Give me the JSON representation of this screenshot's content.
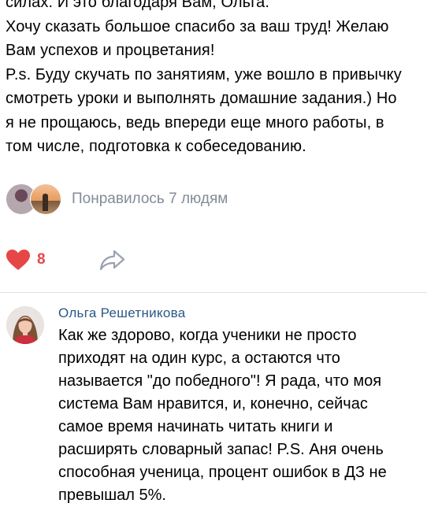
{
  "post": {
    "lines": [
      "силах. И это благодаря Вам, Ольга.",
      "Хочу сказать большое спасибо за ваш труд! Желаю",
      "Вам успехов и процветания!",
      "P.s. Буду скучать по занятиям, уже вошло в привычку",
      "смотреть уроки и выполнять домашние задания.) Но",
      "я не прощаюсь, ведь впереди еще много работы, в",
      "том числе, подготовка к собеседованию."
    ],
    "likes_text": "Понравилось 7 людям",
    "like_count": "8"
  },
  "comment": {
    "author": "Ольга Решетникова",
    "lines": [
      "Как же здорово, когда ученики не просто",
      "приходят на один курс, а остаются что",
      "называется \"до победного\"! Я рада, что моя",
      "система Вам нравится, и, конечно, сейчас",
      "самое время начинать читать книги и",
      "расширять словарный запас! P.S. Аня очень",
      "способная ученица, процент ошибок в ДЗ не",
      "превышал 5%."
    ]
  },
  "colors": {
    "link_blue": "#2a5885",
    "muted_gray": "#818c99",
    "like_red": "#e64646",
    "icon_gray": "#99a2ad",
    "divider": "#dce1e6"
  },
  "icons": {
    "like": "heart-icon",
    "share": "share-arrow-icon"
  }
}
